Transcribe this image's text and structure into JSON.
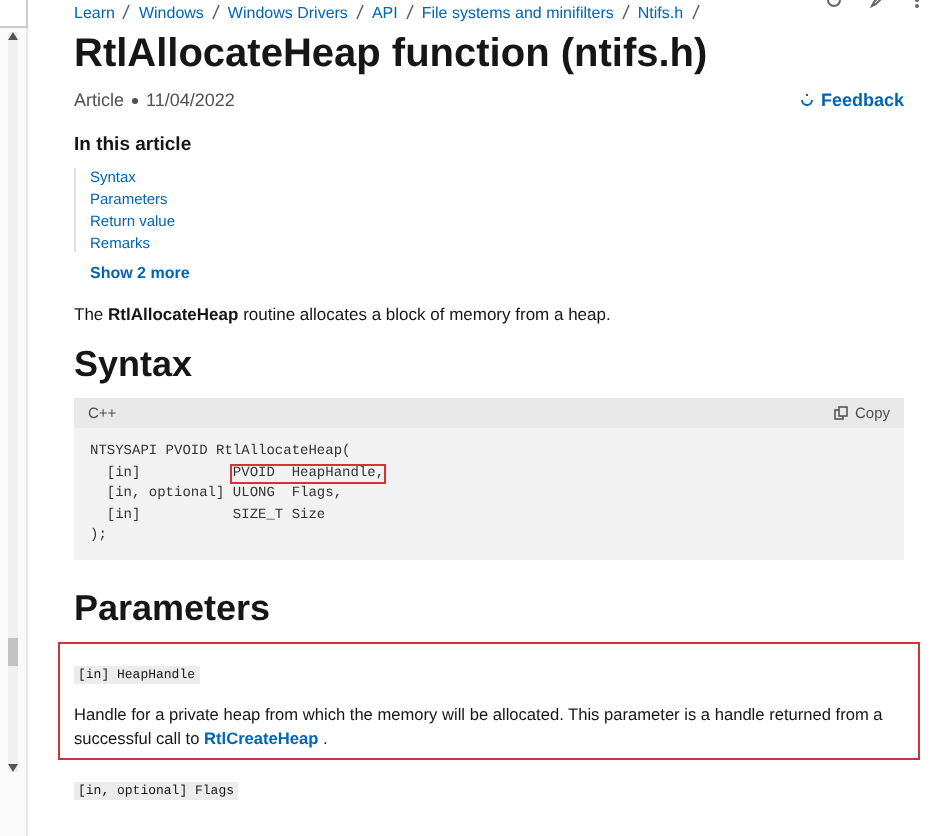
{
  "breadcrumb": [
    "Learn",
    "Windows",
    "Windows Drivers",
    "API",
    "File systems and minifilters",
    "Ntifs.h"
  ],
  "title": "RtlAllocateHeap function (ntifs.h)",
  "meta": {
    "type": "Article",
    "date": "11/04/2022"
  },
  "feedback": "Feedback",
  "toc": {
    "heading": "In this article",
    "items": [
      "Syntax",
      "Parameters",
      "Return value",
      "Remarks"
    ],
    "more": "Show 2 more"
  },
  "description": "The **RtlAllocateHeap** routine allocates a block of memory from a heap.",
  "syntax": {
    "heading": "Syntax",
    "language": "C++",
    "copy": "Copy",
    "lines": [
      {
        "text": "NTSYSAPI PVOID RtlAllocateHeap("
      },
      {
        "text": "  [in]           ",
        "boxed_text": "PVOID  HeapHandle,"
      },
      {
        "text": "  [in, optional] ULONG  Flags,"
      },
      {
        "text": "  [in]           SIZE_T Size"
      },
      {
        "text": ");"
      }
    ]
  },
  "parameters": {
    "heading": "Parameters",
    "items": [
      {
        "name": "[in] HeapHandle",
        "boxed": true,
        "description": "Handle for a private heap from which the memory will be allocated. This parameter is a handle returned from a successful call to ",
        "link": "RtlCreateHeap",
        "after": "."
      },
      {
        "name": "[in, optional] Flags",
        "boxed": false
      }
    ]
  }
}
